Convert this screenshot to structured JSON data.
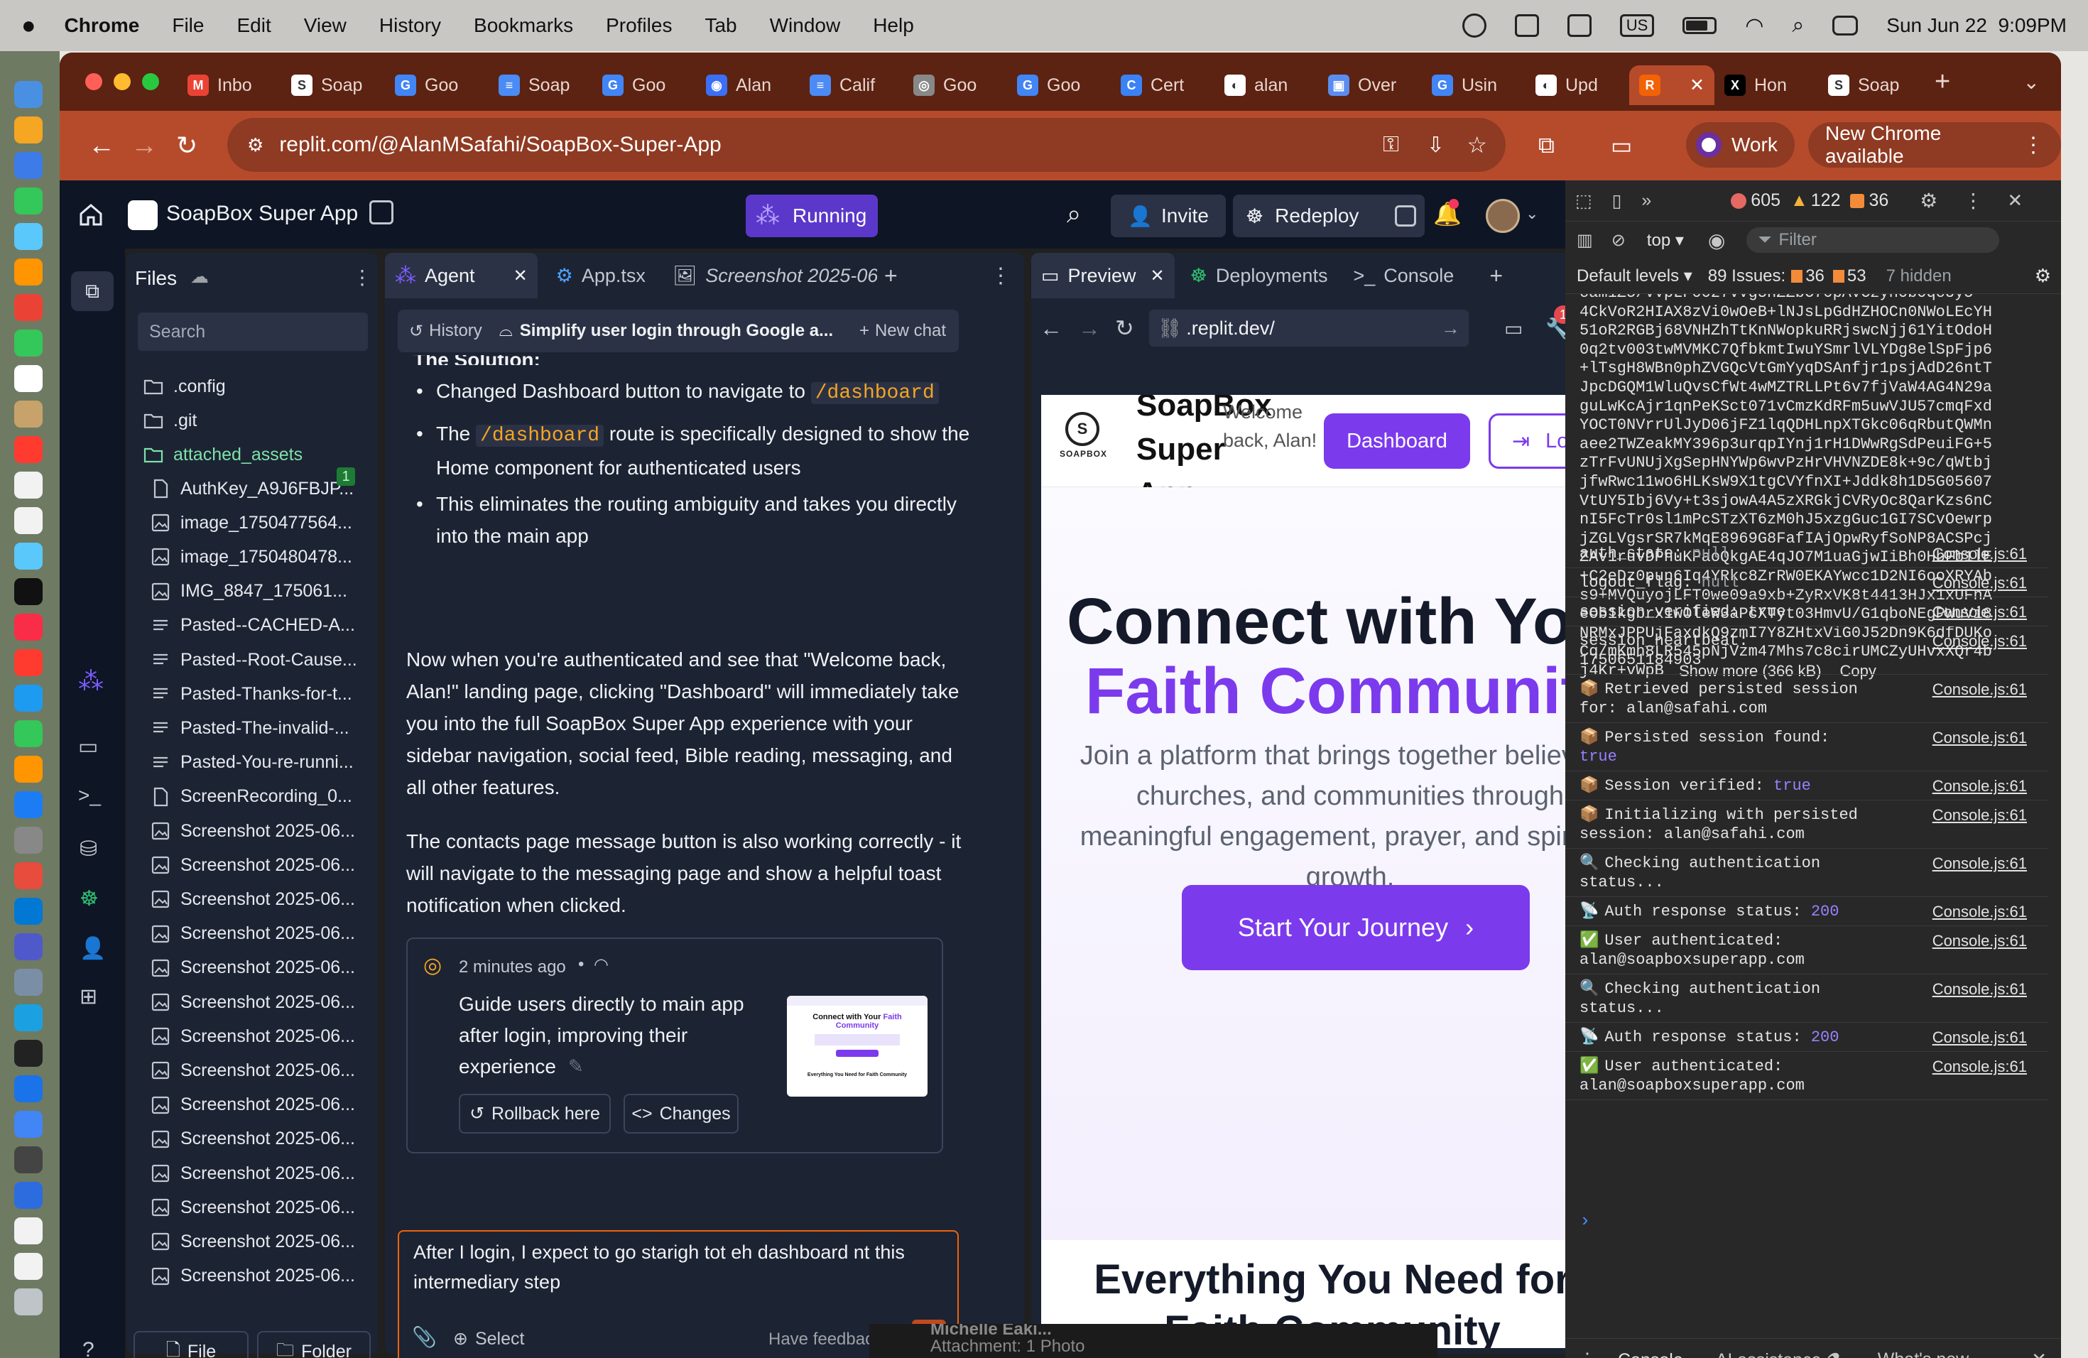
{
  "menubar": {
    "apple": "",
    "app": "Chrome",
    "items": [
      "File",
      "Edit",
      "View",
      "History",
      "Bookmarks",
      "Profiles",
      "Tab",
      "Window",
      "Help"
    ],
    "us": "US",
    "datetime": "Sun Jun 22  9:09PM"
  },
  "tabs": [
    {
      "label": "Inbo",
      "color": "#ea4335",
      "letter": "M"
    },
    {
      "label": "Soap",
      "color": "#ffffff",
      "letter": "S"
    },
    {
      "label": "Goo",
      "color": "#4285f4",
      "letter": "G"
    },
    {
      "label": "Soap",
      "color": "#4b8bf5",
      "letter": "≡"
    },
    {
      "label": "Goo",
      "color": "#4285f4",
      "letter": "G"
    },
    {
      "label": "Alan",
      "color": "#3b6ff5",
      "letter": "◉"
    },
    {
      "label": "Calif",
      "color": "#4b8bf5",
      "letter": "≡"
    },
    {
      "label": "Goo",
      "color": "#888888",
      "letter": "◎"
    },
    {
      "label": "Goo",
      "color": "#4285f4",
      "letter": "G"
    },
    {
      "label": "Cert",
      "color": "#3b82f6",
      "letter": "C"
    },
    {
      "label": "alan",
      "color": "#ffffff",
      "letter": "◐"
    },
    {
      "label": "Over",
      "color": "#5b8def",
      "letter": "▣"
    },
    {
      "label": "Usin",
      "color": "#4285f4",
      "letter": "G"
    },
    {
      "label": "Upd",
      "color": "#ffffff",
      "letter": "◐"
    },
    {
      "label": "",
      "color": "#f26207",
      "letter": "R"
    },
    {
      "label": "Hon",
      "color": "#000000",
      "letter": "X"
    },
    {
      "label": "Soap",
      "color": "#ffffff",
      "letter": "S"
    }
  ],
  "address": {
    "url": "replit.com/@AlanMSafahi/SoapBox-Super-App",
    "profile": "Work",
    "update": "New Chrome available"
  },
  "replit": {
    "project": "SoapBox Super App",
    "running": "Running",
    "invite": "Invite",
    "redeploy": "Redeploy"
  },
  "files": {
    "title": "Files",
    "search": "Search",
    "items": [
      ".config",
      ".git",
      "attached_assets",
      "AuthKey_A9J6FBJP...",
      "image_1750477564...",
      "image_1750480478...",
      "IMG_8847_175061...",
      "Pasted--CACHED-A...",
      "Pasted--Root-Cause...",
      "Pasted-Thanks-for-t...",
      "Pasted-The-invalid-...",
      "Pasted-You-re-runni...",
      "ScreenRecording_0...",
      "Screenshot 2025-06...",
      "Screenshot 2025-06...",
      "Screenshot 2025-06...",
      "Screenshot 2025-06...",
      "Screenshot 2025-06...",
      "Screenshot 2025-06...",
      "Screenshot 2025-06...",
      "Screenshot 2025-06...",
      "Screenshot 2025-06...",
      "Screenshot 2025-06...",
      "Screenshot 2025-06...",
      "Screenshot 2025-06...",
      "Screenshot 2025-06...",
      "Screenshot 2025-06..."
    ],
    "badge": "1",
    "file_btn": "File",
    "folder_btn": "Folder"
  },
  "agent": {
    "tabs": [
      "Agent",
      "App.tsx",
      "Screenshot 2025-06"
    ],
    "history": "History",
    "chat_title": "Simplify user login through Google a...",
    "new_chat": "New chat",
    "solution": "The Solution:",
    "b1a": "Changed Dashboard button to navigate to ",
    "b1code": "/dashboard",
    "b2a": "The ",
    "b2code": "/dashboard",
    "b2b": " route is specifically designed to show the Home component for authenticated users",
    "b3": "This eliminates the routing ambiguity and takes you directly into the main app",
    "p1": "Now when you're authenticated and see that \"Welcome back, Alan!\" landing page, clicking \"Dashboard\" will immediately take you into the full SoapBox Super App experience with your sidebar navigation, social feed, Bible reading, messaging, and all other features.",
    "p2": "The contacts page message button is also working correctly - it will navigate to the messaging page and show a helpful toast notification when clicked.",
    "checkpoint_time": "2 minutes ago",
    "checkpoint_text": "Guide users directly to main app after login, improving their experience",
    "rollback": "Rollback here",
    "changes": "Changes",
    "thumb_title": "Connect with Your",
    "thumb_title2": "Faith",
    "thumb_title3": "Community",
    "thumb_sub": "Everything You Need for Faith Community",
    "input_value": "After I login, I expect to go starigh tot eh dashboard nt this intermediary step",
    "select": "Select",
    "feedback": "Have feedback?"
  },
  "preview": {
    "tabs": [
      "Preview",
      "Deployments",
      "Console"
    ],
    "url": ".replit.dev/",
    "badge": "1",
    "logo": "SOAPBOX",
    "app_title": "SoapBox Super App",
    "welcome": "Welcome back, Alan!",
    "dashboard": "Dashboard",
    "logout": "Logout",
    "hero1": "Connect with Your",
    "hero2": "Faith Community",
    "sub": "Join a platform that brings together believers, churches, and communities through meaningful engagement, prayer, and spiritual growth.",
    "cta": "Start Your Journey",
    "section": "Everything You Need for Faith Community",
    "behind1": "Michelle Eaki...",
    "behind2": "Attachment: 1 Photo"
  },
  "devtools": {
    "errors": "605",
    "warnings": "122",
    "info": "36",
    "context": "top",
    "filter": "Filter",
    "levels": "Default levels",
    "issues": "89 Issues:",
    "iss1": "36",
    "iss2": "53",
    "hidden": "7 hidden",
    "blob": [
      "cam1Z5/VVpLF0027VVg5nZZbC70pAVCzyh0b0qcUy5",
      "4CkVoR2HIAX8zVi0wOeB+lNJsLpGdHZHOCn0NWoLEcYH",
      "51oR2RGBj68VNHZhTtKnNWopkuRRjswcNjj61YitOdoH",
      "0q2tv003twMVMKC7QfbkmtIwuYSmrlVLYDg8elSpFjp6",
      "+lTsgH8WBn0phZVGQcVtGmYyqDSAnfjr1psjAdD26ntT",
      "JpcDGQM1WluQvsCfWt4wMZTRLLPt6v7fjVaW4AG4N29a",
      "guLwKcAjr1qnPeKSct071vCmzKdRFm5uwVJU57cmqFxd",
      "YOCT0NVrrUlJyD06jFZ1lqQDHLnpXTGkc06qRbutQWMn",
      "aee2TWZeakMY396p3urqpIYnj1rH1DWwRgSdPeuiFG+5",
      "zTrFvUNUjXgSepHNYWp6wvPzHrVHVNZDE8k+9c/qWtbj",
      "jfwRwc11wo6HLKsW9X1tgCVYfnXI+Jddk8h1D5G05607",
      "VtUY5Ibj6Vy+t3sjowA4A5zXRGkjCVRyOc8QarKzs6nC",
      "nI5FcTr0sl1mPcSTzXT6zM0hJ5xzgGuc1GI7SCvOewrp",
      "jZGLVgsrSR7kMqE8969G8FafIAjOpwRyfSoNP8ACSPcj",
      "ZAv1ruvDPhuKPaoQkgAE4qJO7M1uaGjwIiBh0HbFb1lE",
      "+C2eDz0pun6Iq4YRkc8ZrRW0EKAYwcc1D2NI6ooXRYAb",
      "s9+MVQuyojLFT0we09a9xb+ZyRxVK8t4413HJx1xUFnA",
      "eOb1kgbrx1wOleW3aPcXTyt03HmvU/G1qboNEgPWuVi8",
      "NRMxJPPUjFaxdkQ9zmI7Y8ZHtxViG0J52Dn9K6dfDUKo",
      "Cq/mKmh8LR545pNjVzm47Mhs7c8cirUMCZyUHvxXQr4b",
      "j4Kr+vWpB"
    ],
    "show_more": "Show more (366 kB)",
    "copy": "Copy",
    "link": "Console.js:61",
    "logs": [
      {
        "t": "auth_state: ",
        "v": "null",
        "vc": "#9aa0a6",
        "ic": ""
      },
      {
        "t": "logout_flag: ",
        "v": "null",
        "vc": "#9aa0a6",
        "ic": ""
      },
      {
        "t": "session_verified: ",
        "v": "true",
        "vc": "#e3e3e3",
        "ic": ""
      },
      {
        "t": "session_heartbeat:",
        "v": "1750651184903",
        "vc": "#e3e3e3",
        "ic": "",
        "br": true
      },
      {
        "t": "Retrieved persisted session for: alan@safahi.com",
        "v": "",
        "ic": "📦"
      },
      {
        "t": "Persisted session found: ",
        "v": "true",
        "vc": "#9980ff",
        "ic": "📦",
        "br": true
      },
      {
        "t": "Session verified: ",
        "v": "true",
        "vc": "#9980ff",
        "ic": "📦"
      },
      {
        "t": "Initializing with persisted session: alan@safahi.com",
        "v": "",
        "ic": "📦"
      },
      {
        "t": "Checking authentication status...",
        "v": "",
        "ic": "🔍"
      },
      {
        "t": "Auth response status: ",
        "v": "200",
        "vc": "#9980ff",
        "ic": "📡"
      },
      {
        "t": "User authenticated: alan@soapboxsuperapp.com",
        "v": "",
        "ic": "✅"
      },
      {
        "t": "Checking authentication status...",
        "v": "",
        "ic": "🔍"
      },
      {
        "t": "Auth response status: ",
        "v": "200",
        "vc": "#9980ff",
        "ic": "📡"
      },
      {
        "t": "User authenticated: alan@soapboxsuperapp.com",
        "v": "",
        "ic": "✅"
      }
    ],
    "bottom_tabs": [
      "Console",
      "AI assistance",
      "What's new"
    ]
  },
  "colors": {
    "replit_bg": "#0e1525",
    "panel": "#1c2333",
    "accent": "#7c3aed",
    "tab_active": "#b64b2c"
  }
}
